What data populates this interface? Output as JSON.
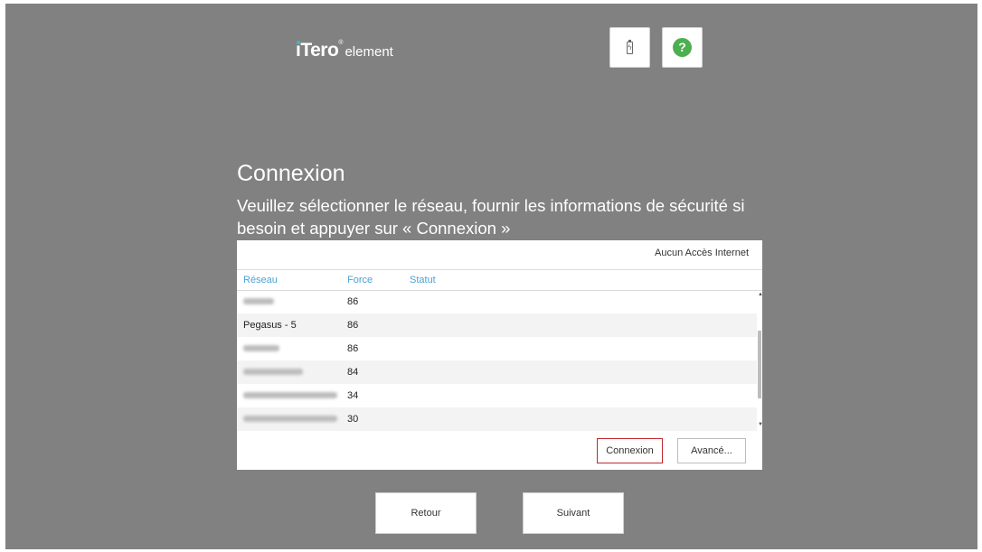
{
  "logo": {
    "brand": "iTero",
    "registered": "®",
    "product": "element"
  },
  "toolbar": {
    "battery_icon": "battery-charging-icon",
    "help_icon": "help-icon",
    "help_glyph": "?",
    "help_color": "#4caf50"
  },
  "page": {
    "title": "Connexion",
    "instructions": "Veuillez sélectionner le réseau, fournir les informations de sécurité si besoin et appuyer sur « Connexion »"
  },
  "panel": {
    "internet_status": "Aucun Accès Internet",
    "columns": {
      "network": "Réseau",
      "strength": "Force",
      "status": "Statut"
    },
    "networks": [
      {
        "name": "",
        "strength": "86",
        "status": "",
        "obscured": true
      },
      {
        "name": "Pegasus - 5",
        "strength": "86",
        "status": "",
        "obscured": false
      },
      {
        "name": "",
        "strength": "86",
        "status": "",
        "obscured": true
      },
      {
        "name": "",
        "strength": "84",
        "status": "",
        "obscured": true
      },
      {
        "name": "",
        "strength": "34",
        "status": "",
        "obscured": true
      },
      {
        "name": "",
        "strength": "30",
        "status": "",
        "obscured": true
      }
    ],
    "connect_label": "Connexion",
    "advanced_label": "Avancé..."
  },
  "nav": {
    "back_label": "Retour",
    "next_label": "Suivant"
  },
  "colors": {
    "background": "#818181",
    "accent": "#4aa3d6",
    "focus": "#c0282f"
  }
}
